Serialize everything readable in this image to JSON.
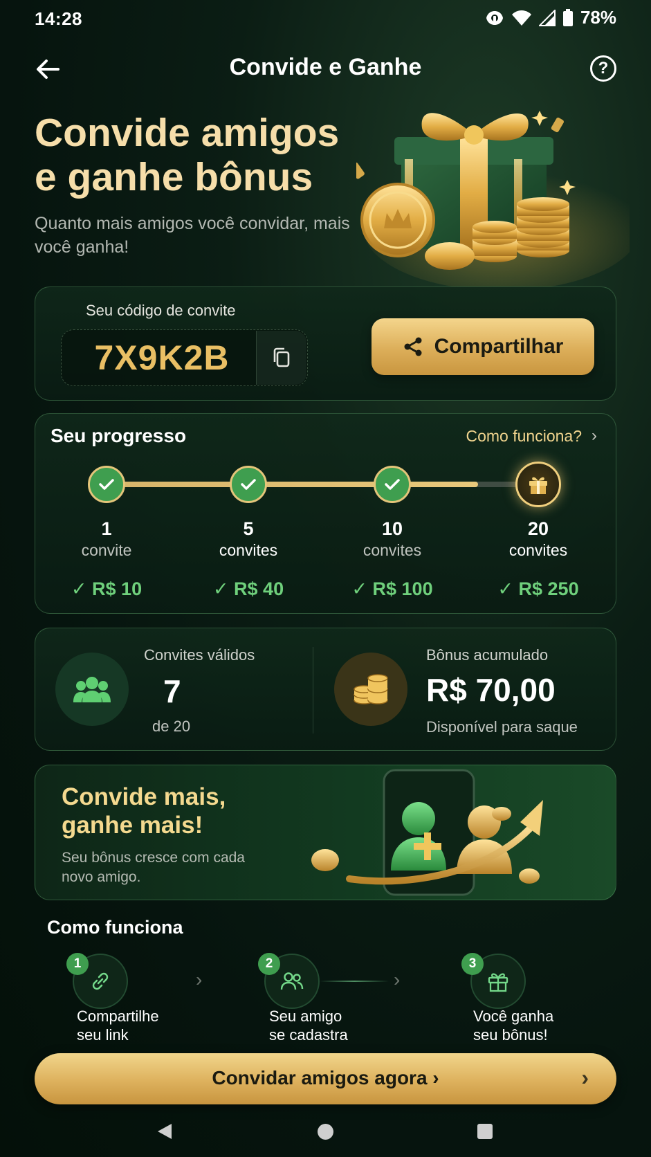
{
  "status_bar": {
    "time": "14:28",
    "battery": "78%"
  },
  "header": {
    "title": "Convide e Ganhe",
    "help_symbol": "?"
  },
  "hero": {
    "title_line1": "Convide amigos",
    "title_line2": "e ganhe bônus",
    "subtitle": "Quanto mais amigos você convidar, mais você ganha!"
  },
  "invite": {
    "label": "Seu código de convite",
    "code": "7X9K2B",
    "share_label": "Compartilhar"
  },
  "progress": {
    "title": "Seu progresso",
    "how_link": "Como funciona?",
    "fill_fraction": 0.86,
    "milestones": [
      {
        "count": "1",
        "unit": "convite",
        "reward": "R$ 10",
        "achieved": true
      },
      {
        "count": "5",
        "unit": "convites",
        "reward": "R$ 40",
        "achieved": true
      },
      {
        "count": "10",
        "unit": "convites",
        "reward": "R$ 100",
        "achieved": true
      },
      {
        "count": "20",
        "unit": "convites",
        "reward": "R$ 250",
        "achieved": false
      }
    ]
  },
  "stats": {
    "valid_label": "Convites válidos",
    "valid_value": "7",
    "valid_of": "de 20",
    "bonus_label": "Bônus acumulado",
    "bonus_value": "R$ 70,00",
    "bonus_sub": "Disponível para saque"
  },
  "promo": {
    "title_line1": "Convide mais,",
    "title_line2": "ganhe mais!",
    "subtitle": "Seu bônus cresce com cada novo amigo."
  },
  "how_it_works": {
    "title": "Como funciona",
    "steps": [
      {
        "number": "1",
        "line1": "Compartilhe",
        "line2": "seu link",
        "icon": "link-icon"
      },
      {
        "number": "2",
        "line1": "Seu amigo",
        "line2": "se cadastra",
        "icon": "users-icon"
      },
      {
        "number": "3",
        "line1": "Você ganha",
        "line2": "seu bônus!",
        "icon": "gift-icon"
      }
    ]
  },
  "cta": {
    "label": "Convidar amigos agora"
  },
  "colors": {
    "gold": "#e9bf64",
    "green": "#3f9e4f",
    "reward_green": "#6fd07c",
    "background": "#06140e"
  }
}
